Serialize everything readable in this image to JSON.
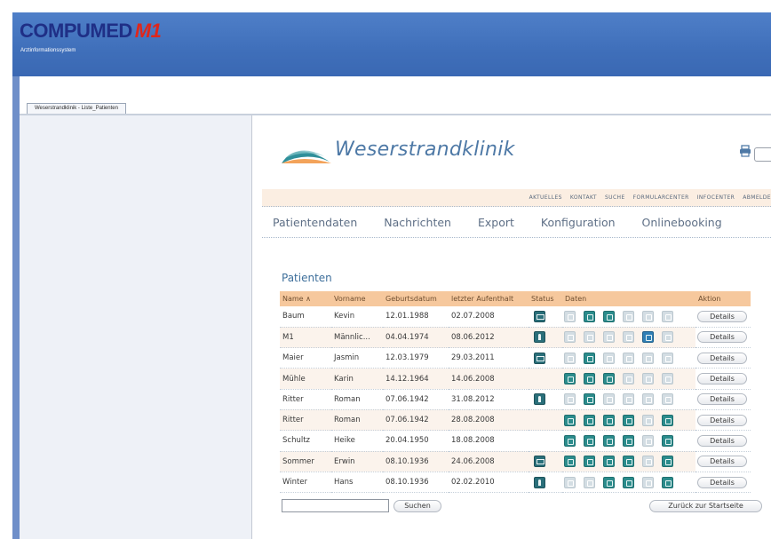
{
  "app": {
    "brand_name": "COMPUMED",
    "brand_number": "M1",
    "subtitle": "Arztinformationssystem",
    "tab_label": "Weserstrandklinik - Liste_Patienten"
  },
  "clinic": {
    "name": "Weserstrandklinik"
  },
  "top_links": [
    "AKTUELLES",
    "KONTAKT",
    "SUCHE",
    "FORMULARCENTER",
    "INFOCENTER",
    "ABMELDE"
  ],
  "main_nav": [
    "Patientendaten",
    "Nachrichten",
    "Export",
    "Konfiguration",
    "Onlinebooking"
  ],
  "section_title": "Patienten",
  "table": {
    "headers": {
      "name": "Name ∧",
      "vorname": "Vorname",
      "geburtsdatum": "Geburtsdatum",
      "aufenthalt": "letzter Aufenthalt",
      "status": "Status",
      "daten": "Daten",
      "aktion": "Aktion"
    },
    "details_label": "Details",
    "rows": [
      {
        "name": "Baum",
        "vorname": "Kevin",
        "geburtsdatum": "12.01.1988",
        "aufenthalt": "02.07.2008",
        "status": "document",
        "daten": [
          false,
          true,
          true,
          false,
          false,
          false
        ]
      },
      {
        "name": "M1",
        "vorname": "Männlic...",
        "geburtsdatum": "04.04.1974",
        "aufenthalt": "08.06.2012",
        "status": "person",
        "daten": [
          false,
          false,
          false,
          false,
          true,
          false
        ]
      },
      {
        "name": "Maier",
        "vorname": "Jasmin",
        "geburtsdatum": "12.03.1979",
        "aufenthalt": "29.03.2011",
        "status": "document",
        "daten": [
          false,
          true,
          false,
          false,
          false,
          false
        ]
      },
      {
        "name": "Mühle",
        "vorname": "Karin",
        "geburtsdatum": "14.12.1964",
        "aufenthalt": "14.06.2008",
        "status": "",
        "daten": [
          true,
          true,
          true,
          false,
          false,
          false
        ]
      },
      {
        "name": "Ritter",
        "vorname": "Roman",
        "geburtsdatum": "07.06.1942",
        "aufenthalt": "31.08.2012",
        "status": "person",
        "daten": [
          false,
          true,
          false,
          false,
          false,
          false
        ]
      },
      {
        "name": "Ritter",
        "vorname": "Roman",
        "geburtsdatum": "07.06.1942",
        "aufenthalt": "28.08.2008",
        "status": "",
        "daten": [
          true,
          true,
          true,
          true,
          false,
          true
        ]
      },
      {
        "name": "Schultz",
        "vorname": "Heike",
        "geburtsdatum": "20.04.1950",
        "aufenthalt": "18.08.2008",
        "status": "",
        "daten": [
          true,
          true,
          true,
          true,
          false,
          true
        ]
      },
      {
        "name": "Sommer",
        "vorname": "Erwin",
        "geburtsdatum": "08.10.1936",
        "aufenthalt": "24.06.2008",
        "status": "document",
        "daten": [
          true,
          true,
          true,
          true,
          false,
          true
        ]
      },
      {
        "name": "Winter",
        "vorname": "Hans",
        "geburtsdatum": "08.10.1936",
        "aufenthalt": "02.02.2010",
        "status": "person",
        "daten": [
          false,
          false,
          true,
          true,
          false,
          true
        ]
      }
    ]
  },
  "search": {
    "value": "",
    "button_label": "Suchen"
  },
  "back_button_label": "Zurück zur Startseite",
  "colors": {
    "header_blue": "#3f6fba",
    "brand_navy": "#1f2f86",
    "brand_red": "#e0261a",
    "table_header": "#f6c89d",
    "icon_active": "#2b8c8c"
  },
  "icons": {
    "print": "printer-icon",
    "status_document": "document-icon",
    "status_person": "person-icon"
  }
}
